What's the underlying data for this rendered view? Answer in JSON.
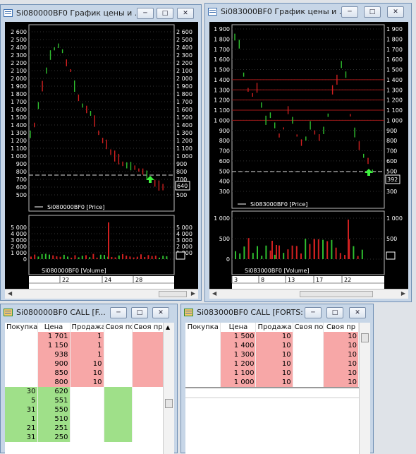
{
  "win1": {
    "title": "Si080000BF0 График цены и ...",
    "price_axis": [
      "2 600",
      "2 500",
      "2 400",
      "2 300",
      "2 200",
      "2 100",
      "2 000",
      "1 900",
      "1 800",
      "1 700",
      "1 600",
      "1 500",
      "1 400",
      "1 300",
      "1 200",
      "1 100",
      "1 000",
      "900",
      "800",
      "700",
      "600",
      "500"
    ],
    "price_axis_right": [
      "2 600",
      "2 500",
      "2 400",
      "2 300",
      "2 200",
      "2 100",
      "2 000",
      "1 900",
      "1 800",
      "1 700",
      "1 600",
      "1 500",
      "1 400",
      "1 300",
      "1 200",
      "1 100",
      "1 000",
      "900",
      "800",
      "700",
      "600",
      "500"
    ],
    "price_last": "640",
    "price_legend": "Si080000BF0 [Price]",
    "volume_axis": [
      "5 000",
      "4 000",
      "3 000",
      "2 000",
      "1 000",
      "0"
    ],
    "volume_axis_right": [
      "5 000",
      "4 000",
      "3 000",
      "2 000",
      "1 000"
    ],
    "volume_legend": "Si080000BF0 [Volume]",
    "dates": [
      "22",
      "24",
      "28"
    ]
  },
  "win2": {
    "title": "Si083000BF0 График цены и ...",
    "price_axis": [
      "1 900",
      "1 800",
      "1 700",
      "1 600",
      "1 500",
      "1 400",
      "1 300",
      "1 200",
      "1 100",
      "1 000",
      "900",
      "800",
      "700",
      "600",
      "500",
      "400",
      "300"
    ],
    "price_axis_right": [
      "1 900",
      "1 800",
      "1 700",
      "1 600",
      "1 500",
      "1 400",
      "1 300",
      "1 200",
      "1 100",
      "1 000",
      "900",
      "800",
      "700",
      "600",
      "500",
      "400",
      "300"
    ],
    "price_last": "392",
    "price_legend": "Si083000BF0 [Price]",
    "volume_axis": [
      "1 000",
      "500",
      "0"
    ],
    "volume_axis_right": [
      "1 000",
      "500"
    ],
    "volume_legend": "Si083000BF0 [Volume]",
    "dates": [
      "3",
      "8",
      "13",
      "17",
      "22"
    ]
  },
  "win3": {
    "title": "Si080000BF0 CALL [F...",
    "headers": [
      "Покупка",
      "Цена",
      "Продажа",
      "Своя по",
      "Своя пр"
    ],
    "rows": [
      {
        "buy": "",
        "price": "1 701",
        "sell": "1"
      },
      {
        "buy": "",
        "price": "1 150",
        "sell": "1"
      },
      {
        "buy": "",
        "price": "938",
        "sell": "1"
      },
      {
        "buy": "",
        "price": "900",
        "sell": "10"
      },
      {
        "buy": "",
        "price": "850",
        "sell": "10"
      },
      {
        "buy": "",
        "price": "800",
        "sell": "10"
      },
      {
        "buy": "30",
        "price": "620",
        "sell": ""
      },
      {
        "buy": "5",
        "price": "551",
        "sell": ""
      },
      {
        "buy": "31",
        "price": "550",
        "sell": ""
      },
      {
        "buy": "1",
        "price": "510",
        "sell": ""
      },
      {
        "buy": "21",
        "price": "251",
        "sell": ""
      },
      {
        "buy": "31",
        "price": "250",
        "sell": ""
      }
    ]
  },
  "win4": {
    "title": "Si083000BF0 CALL [FORTS:...",
    "headers": [
      "Покупка",
      "Цена",
      "Продажа",
      "Своя по",
      "Своя пр"
    ],
    "rows": [
      {
        "price": "1 500",
        "sell": "10",
        "own": "10"
      },
      {
        "price": "1 400",
        "sell": "10",
        "own": "10"
      },
      {
        "price": "1 300",
        "sell": "10",
        "own": "10"
      },
      {
        "price": "1 200",
        "sell": "10",
        "own": "10"
      },
      {
        "price": "1 100",
        "sell": "10",
        "own": "10"
      },
      {
        "price": "1 000",
        "sell": "10",
        "own": "10"
      }
    ]
  },
  "colors": {
    "up": "#2fbf2f",
    "down": "#d02020",
    "ask_bg": "#f7a7a7",
    "bid_bg": "#9fe089"
  }
}
